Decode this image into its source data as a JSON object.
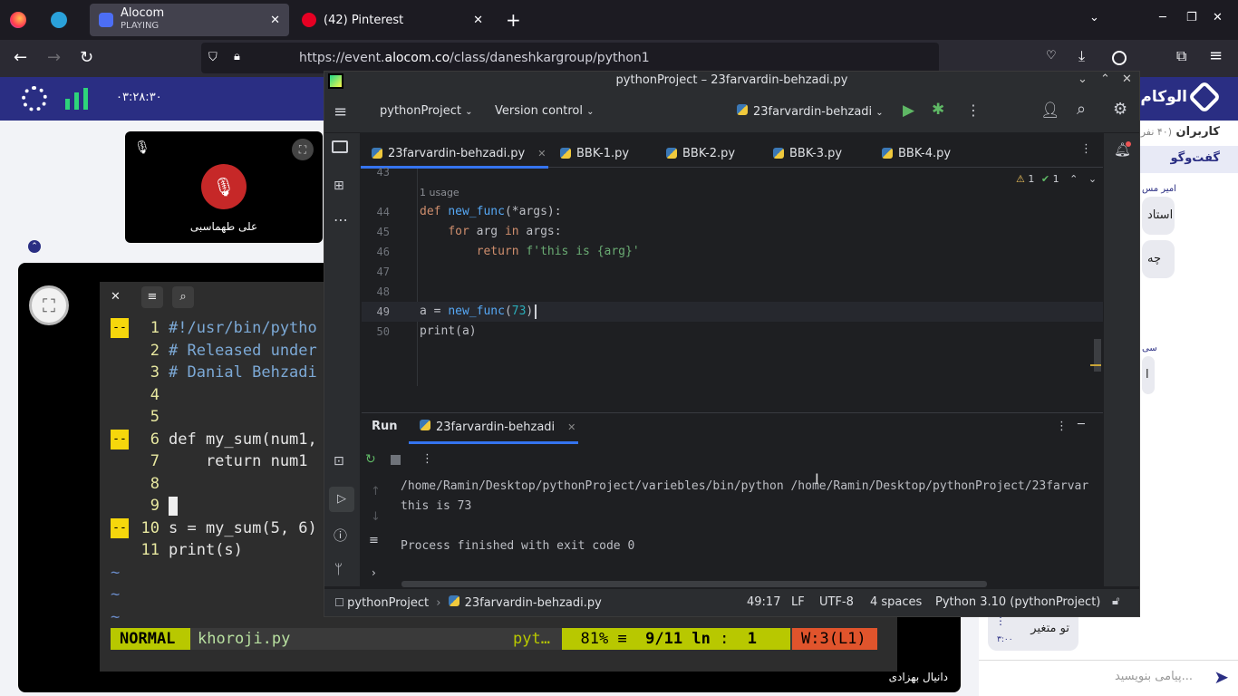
{
  "browser": {
    "tabs": [
      {
        "title": "Alocom",
        "subtitle": "PLAYING",
        "active": true
      },
      {
        "title": "(42) Pinterest",
        "active": false
      }
    ],
    "url_prefix": "https://event.",
    "url_domain": "alocom.co",
    "url_path": "/class/daneshkargroup/python1"
  },
  "alocom": {
    "timer": "۰۳:۲۸:۳۰",
    "brand": "الوکام",
    "users_label": "کاربران",
    "users_count": "(۴۰ نفر)",
    "chat_label": "گفت‌وگو",
    "chat_placeholder": "پیامی بنویسید...",
    "participant_name": "علی طهماسبی",
    "presenter_name": "دانیال بهزادی",
    "messages": [
      {
        "author": "امیر مس",
        "text": "استاد"
      },
      {
        "text": "چه"
      },
      {
        "author": "سی",
        "text": "ا"
      },
      {
        "text": "تو متغیر",
        "time": "۳:۰۰"
      }
    ]
  },
  "vim": {
    "lines": [
      {
        "n": "1",
        "text": "#!/usr/bin/pytho",
        "mark": "--"
      },
      {
        "n": "2",
        "text": "# Released under",
        "mark": ""
      },
      {
        "n": "3",
        "text": "# Danial Behzadi",
        "mark": ""
      },
      {
        "n": "4",
        "text": "",
        "mark": ""
      },
      {
        "n": "5",
        "text": "",
        "mark": ""
      },
      {
        "n": "6",
        "text": "def my_sum(num1,",
        "mark": "--"
      },
      {
        "n": "7",
        "text": "    return num1",
        "mark": ""
      },
      {
        "n": "8",
        "text": "",
        "mark": ""
      },
      {
        "n": "9",
        "text": "",
        "mark": ""
      },
      {
        "n": "10",
        "text": "s = my_sum(5, 6)",
        "mark": "--"
      },
      {
        "n": "11",
        "text": "print(s)",
        "mark": ""
      }
    ],
    "tildes": [
      "~",
      "~",
      "~"
    ],
    "mode": "NORMAL",
    "filename": "khoroji.py",
    "filetype": "pyt…",
    "percent": "81%",
    "position": "9/11",
    "ln_label": "ln",
    "col": "1",
    "warning": "W:3(L1)"
  },
  "pycharm": {
    "title": "pythonProject – 23farvardin-behzadi.py",
    "project": "pythonProject",
    "vcs": "Version control",
    "run_config": "23farvardin-behzadi",
    "tabs": [
      "23farvardin-behzadi.py",
      "BBK-1.py",
      "BBK-2.py",
      "BBK-3.py",
      "BBK-4.py"
    ],
    "usage_hint": "1 usage",
    "inspections": {
      "warnings": "1",
      "ok": "1"
    },
    "code": [
      {
        "n": "43",
        "text": ""
      },
      {
        "n": "44",
        "text": "def new_func(*args):"
      },
      {
        "n": "45",
        "text": "    for arg in args:"
      },
      {
        "n": "46",
        "text": "        return f'this is {arg}'"
      },
      {
        "n": "47",
        "text": ""
      },
      {
        "n": "48",
        "text": ""
      },
      {
        "n": "49",
        "text": "a = new_func(73)"
      },
      {
        "n": "50",
        "text": "print(a)"
      }
    ],
    "run_label": "Run",
    "run_tab": "23farvardin-behzadi",
    "console": [
      "/home/Ramin/Desktop/pythonProject/varieb​les/bin/python /home/Ramin/Desktop/pythonProject/23farvar",
      "this is 73",
      "",
      "Process finished with exit code 0"
    ],
    "breadcrumb": [
      "pythonProject",
      "23farvardin-behzadi.py"
    ],
    "status": {
      "cursor": "49:17",
      "line_sep": "LF",
      "encoding": "UTF-8",
      "indent": "4 spaces",
      "interpreter": "Python 3.10 (pythonProject)"
    }
  },
  "colors": {
    "alocom_header": "#2a2e83",
    "pycharm_bg": "#1e1f22",
    "vim_status_green": "#b8c800",
    "vim_warn": "#e0542c"
  }
}
